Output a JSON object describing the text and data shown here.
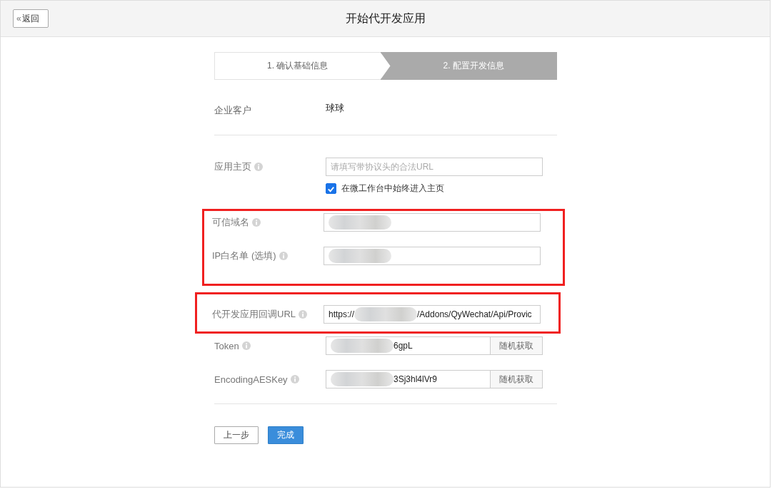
{
  "header": {
    "back_button": {
      "icon": "«",
      "label": "返回"
    },
    "title": "开始代开发应用"
  },
  "steps": [
    {
      "label": "1. 确认基础信息",
      "selected": false
    },
    {
      "label": "2. 配置开发信息",
      "selected": true
    }
  ],
  "customer": {
    "label": "企业客户",
    "value": "球球"
  },
  "sections": [
    {
      "highlighted": false,
      "fields": [
        {
          "label": "应用主页",
          "placeholder": "请填写带协议头的合法URL",
          "checkbox": {
            "label": "在微工作台中始终进入主页",
            "checked": true
          }
        }
      ]
    },
    {
      "highlighted": true,
      "fields": [
        {
          "label": "可信域名",
          "redacted": true
        },
        {
          "label": "IP白名单 (选填)",
          "redacted": true
        }
      ]
    },
    {
      "highlighted": true,
      "fields": [
        {
          "label": "代开发应用回调URL",
          "prefix": "https://",
          "redacted": true,
          "suffix": "/Addons/QyWechat/Api/Provic"
        }
      ]
    },
    {
      "highlighted": false,
      "fields": [
        {
          "label": "Token",
          "redacted": true,
          "suffix": "6gpL",
          "button": "随机获取"
        },
        {
          "label": "EncodingAESKey",
          "redacted": true,
          "suffix": "3Sj3hl4lVr9",
          "button": "随机获取"
        }
      ]
    }
  ],
  "buttons": [
    {
      "label": "上一步",
      "kind": "secondary"
    },
    {
      "label": "完成",
      "kind": "primary"
    }
  ]
}
